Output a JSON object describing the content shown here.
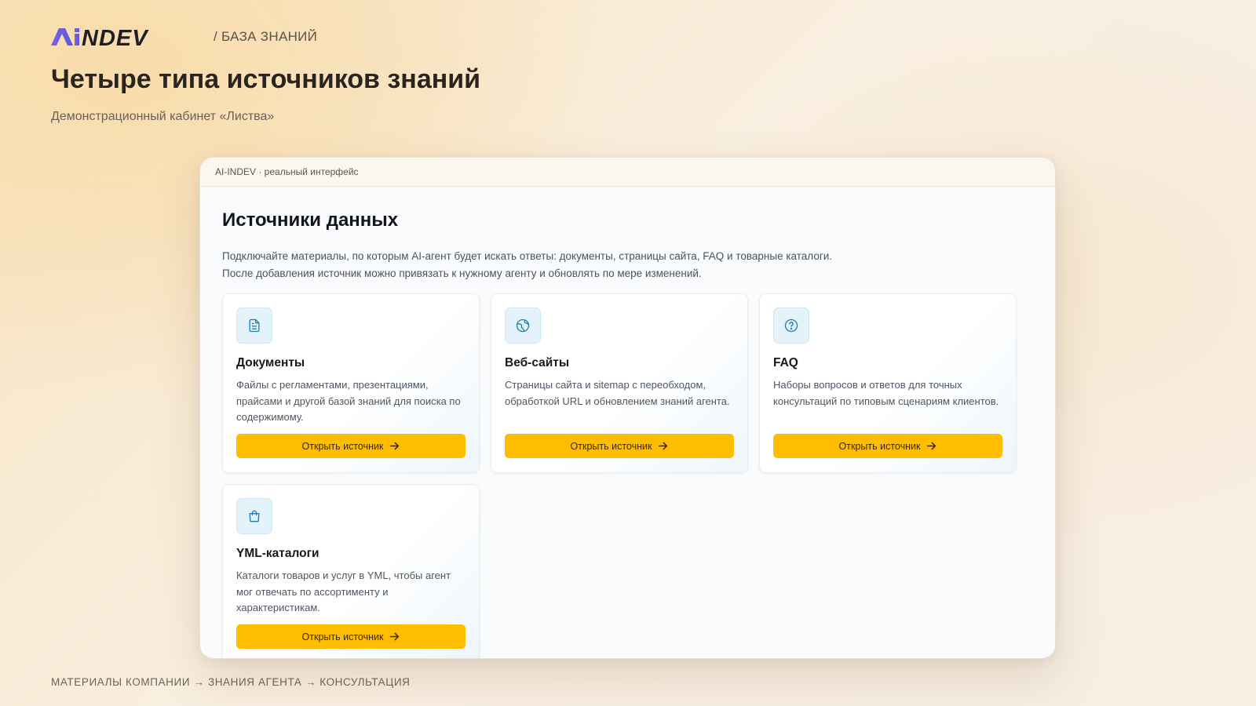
{
  "header": {
    "logo_text": "AiNDEV",
    "breadcrumb": "/ БАЗА ЗНАНИЙ",
    "title": "Четыре типа источников знаний",
    "subtitle": "Демонстрационный кабинет «Листва»"
  },
  "window": {
    "bar_label": "AI-INDEV · реальный интерфейс",
    "section_title": "Источники данных",
    "section_description": "Подключайте материалы, по которым AI-агент будет искать ответы: документы, страницы сайта, FAQ и товарные каталоги. После добавления источник можно привязать к нужному агенту и обновлять по мере изменений.",
    "cards": [
      {
        "icon": "document-icon",
        "title": "Документы",
        "description": "Файлы с регламентами, презентациями, прайсами и другой базой знаний для поиска по содержимому.",
        "button": "Открыть источник"
      },
      {
        "icon": "globe-icon",
        "title": "Веб-сайты",
        "description": "Страницы сайта и sitemap с переобходом, обработкой URL и обновлением знаний агента.",
        "button": "Открыть источник"
      },
      {
        "icon": "question-circle-icon",
        "title": "FAQ",
        "description": "Наборы вопросов и ответов для точных консультаций по типовым сценариям клиентов.",
        "button": "Открыть источник"
      },
      {
        "icon": "shopping-bag-icon",
        "title": "YML-каталоги",
        "description": "Каталоги товаров и услуг в YML, чтобы агент мог отвечать по ассортименту и характеристикам.",
        "button": "Открыть источник"
      }
    ]
  },
  "footer": {
    "flow": "МАТЕРИАЛЫ КОМПАНИИ → ЗНАНИЯ АГЕНТА → КОНСУЛЬТАЦИЯ"
  },
  "colors": {
    "accent_button": "#ffbd00",
    "logo_purple": "#6a5fd8",
    "logo_dark": "#1e1e26",
    "icon_tint": "#1f7fa8"
  }
}
